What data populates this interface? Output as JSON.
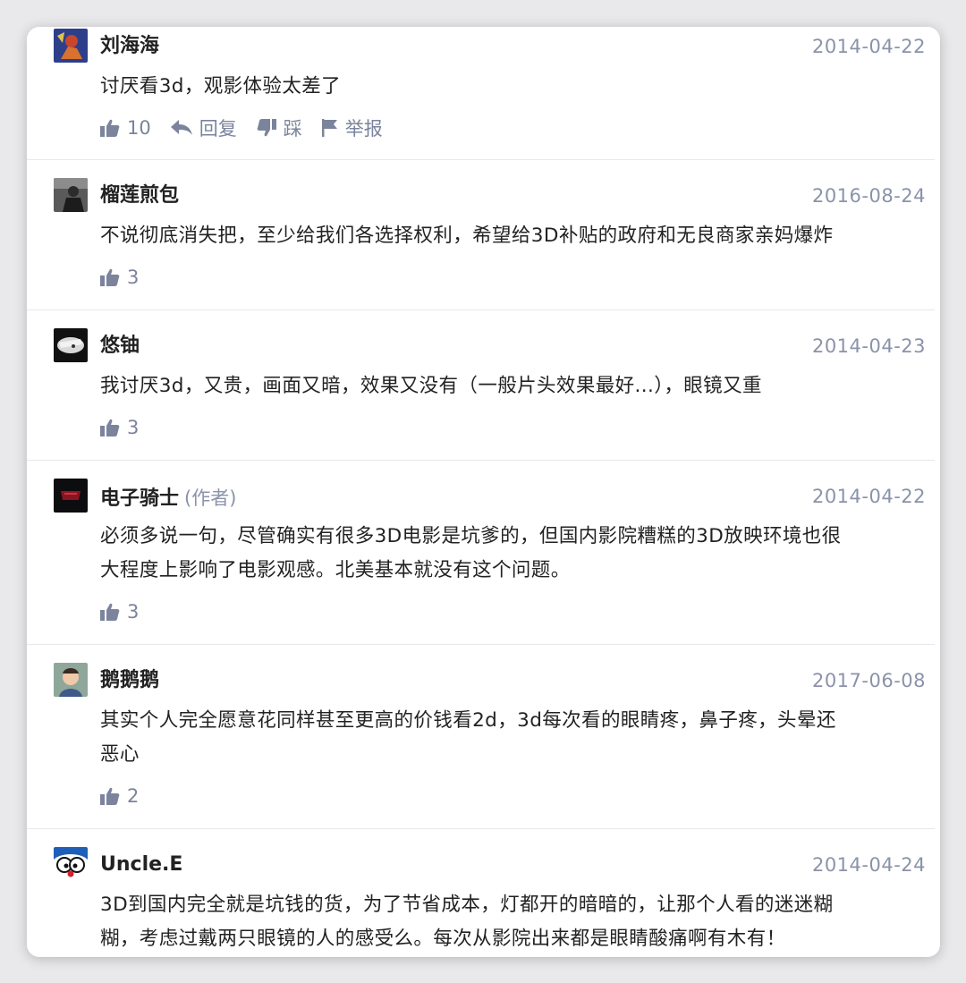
{
  "comments": [
    {
      "username": "刘海海",
      "date": "2014-04-22",
      "text": "讨厌看3d，观影体验太差了",
      "likes": "10",
      "reply_label": "回复",
      "dislike_label": "踩",
      "report_label": "举报"
    },
    {
      "username": "榴莲煎包",
      "date": "2016-08-24",
      "text": "不说彻底消失把，至少给我们各选择权利，希望给3D补贴的政府和无良商家亲妈爆炸",
      "likes": "3"
    },
    {
      "username": "悠铀",
      "date": "2014-04-23",
      "text": "我讨厌3d，又贵，画面又暗，效果又没有（一般片头效果最好...），眼镜又重",
      "likes": "3"
    },
    {
      "username": "电子骑士",
      "author_tag": "(作者)",
      "date": "2014-04-22",
      "text_line1": "必须多说一句，尽管确实有很多3D电影是坑爹的，但国内影院糟糕的3D放映环境也很",
      "text_line2": "大程度上影响了电影观感。北美基本就没有这个问题。",
      "likes": "3"
    },
    {
      "username": "鹅鹅鹅",
      "date": "2017-06-08",
      "text_line1": "其实个人完全愿意花同样甚至更高的价钱看2d，3d每次看的眼睛疼，鼻子疼，头晕还",
      "text_line2": "恶心",
      "likes": "2"
    },
    {
      "username": "Uncle.E",
      "date": "2014-04-24",
      "text_line1": "3D到国内完全就是坑钱的货，为了节省成本，灯都开的暗暗的，让那个人看的迷迷糊",
      "text_line2": "糊，考虑过戴两只眼镜的人的感受么。每次从影院出来都是眼睛酸痛啊有木有！"
    }
  ],
  "icons": {
    "like": "thumbs-up-icon",
    "reply": "reply-arrow-icon",
    "dislike": "thumbs-down-icon",
    "report": "flag-icon"
  },
  "colors": {
    "meta": "#8a93aa",
    "action": "#7b849c",
    "text": "#222222"
  }
}
